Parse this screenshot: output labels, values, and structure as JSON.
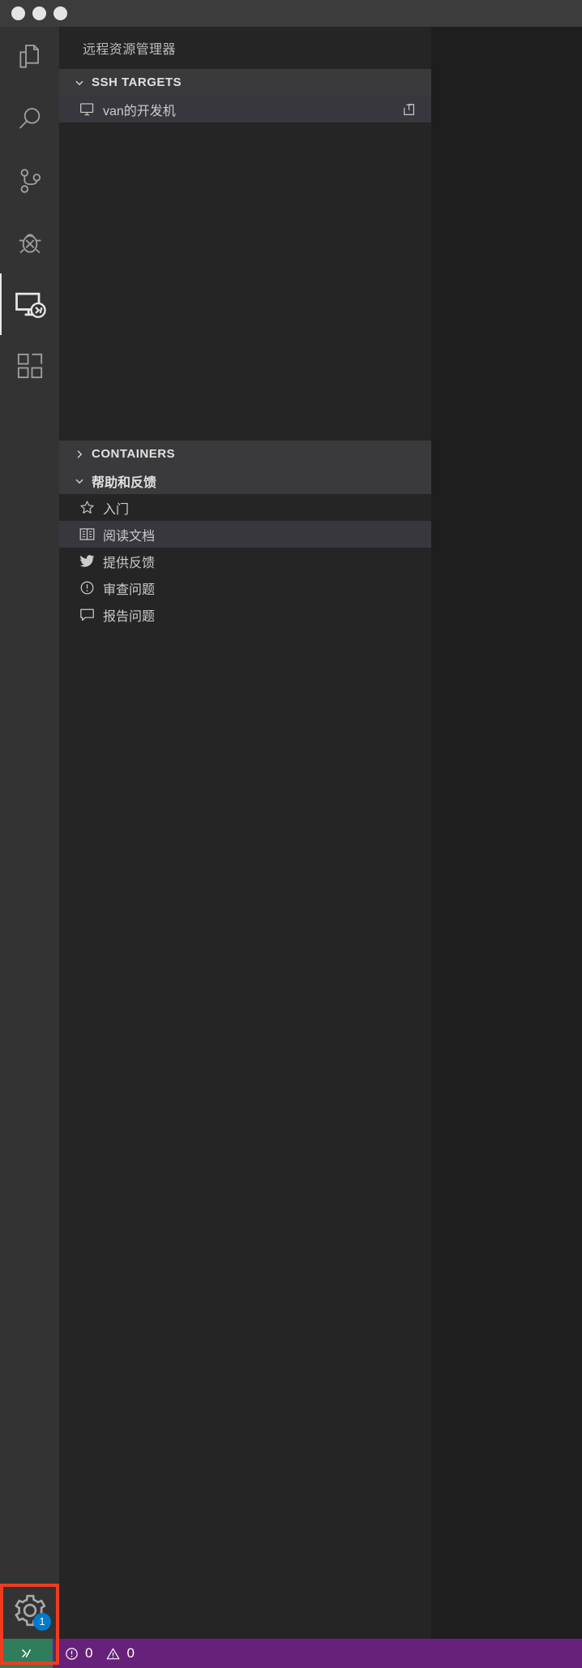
{
  "window": {
    "traffic_lights": [
      "close-button",
      "minimize-button",
      "maximize-button"
    ]
  },
  "activity_bar": {
    "items": [
      {
        "name": "explorer",
        "icon": "files-icon",
        "active": false
      },
      {
        "name": "search",
        "icon": "search-icon",
        "active": false
      },
      {
        "name": "source-control",
        "icon": "source-control-icon",
        "active": false
      },
      {
        "name": "run-and-debug",
        "icon": "debug-icon",
        "active": false
      },
      {
        "name": "remote-explorer",
        "icon": "remote-explorer-icon",
        "active": true
      },
      {
        "name": "extensions",
        "icon": "extensions-icon",
        "active": false
      }
    ],
    "manage": {
      "icon": "gear-icon",
      "badge": "1",
      "badge_color": "#007acc"
    }
  },
  "sidebar": {
    "title": "远程资源管理器",
    "sections": [
      {
        "id": "ssh-targets",
        "label": "SSH TARGETS",
        "expanded": true,
        "twisty": "chevron-down-icon",
        "items": [
          {
            "label": "van的开发机",
            "icon": "remote-machine-icon",
            "action_icon": "open-in-new-window-icon",
            "selected": true
          }
        ]
      },
      {
        "id": "containers",
        "label": "CONTAINERS",
        "expanded": false,
        "twisty": "chevron-right-icon",
        "items": []
      },
      {
        "id": "help-and-feedback",
        "label": "帮助和反馈",
        "expanded": true,
        "twisty": "chevron-down-icon",
        "items": [
          {
            "label": "入门",
            "icon": "star-icon",
            "selected": false
          },
          {
            "label": "阅读文档",
            "icon": "book-icon",
            "selected": true
          },
          {
            "label": "提供反馈",
            "icon": "twitter-icon",
            "selected": false
          },
          {
            "label": "审查问题",
            "icon": "issues-icon",
            "selected": false
          },
          {
            "label": "报告问题",
            "icon": "comment-icon",
            "selected": false
          }
        ]
      }
    ]
  },
  "status_bar": {
    "background": "#68217a",
    "remote": {
      "icon": "remote-indicator-icon",
      "background": "#2f7d5b"
    },
    "problems": [
      {
        "icon": "error-icon",
        "count": "0"
      },
      {
        "icon": "warning-icon",
        "count": "0"
      }
    ]
  },
  "annotation": {
    "highlight_rect_color": "#f03c1e"
  }
}
